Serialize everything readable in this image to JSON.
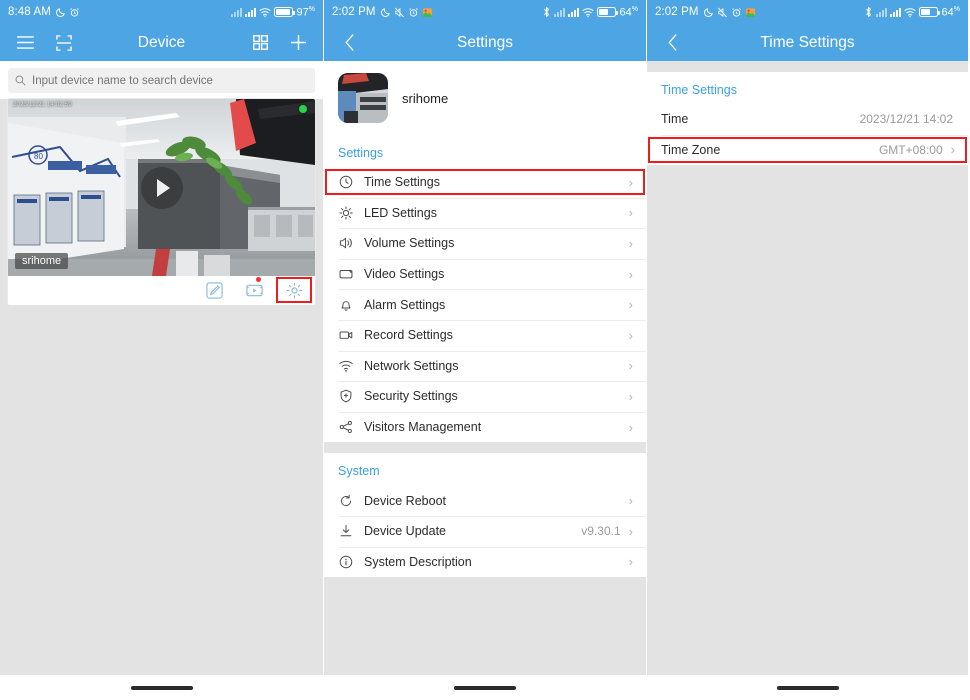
{
  "panel1": {
    "status": {
      "time": "8:48 AM",
      "battery": "97",
      "battery_pct_sym": "%",
      "icons": [
        "moon-icon",
        "alarm-icon",
        "signal-dim-icon",
        "signal-icon",
        "wifi-icon",
        "battery-icon"
      ]
    },
    "nav": {
      "title": "Device",
      "menu_icon": "hamburger-icon",
      "scan_icon": "scan-icon",
      "grid_icon": "grid-view-icon",
      "add_icon": "plus-icon"
    },
    "search": {
      "placeholder": "Input device name to search device",
      "value": "",
      "icon": "search-icon"
    },
    "device": {
      "name": "srihome",
      "timestamp_overlay": "2023/12/21 14:02:59",
      "online": true,
      "tools": [
        "edit-icon",
        "playback-icon",
        "settings-gear-icon"
      ],
      "highlight": "settings-gear-icon"
    }
  },
  "panel2": {
    "status": {
      "time": "2:02 PM",
      "battery": "64",
      "battery_pct_sym": "%",
      "icons": [
        "moon-icon",
        "mute-icon",
        "alarm-icon",
        "photo-icon",
        "bluetooth-icon",
        "signal-dim-icon",
        "signal-icon",
        "wifi-icon",
        "battery-icon"
      ]
    },
    "nav": {
      "title": "Settings",
      "back_icon": "chevron-left-icon"
    },
    "profile": {
      "name": "srihome",
      "avatar": "device-thumbnail"
    },
    "sections": [
      {
        "title": "Settings",
        "items": [
          {
            "label": "Time Settings",
            "icon": "clock-icon",
            "value": "",
            "highlighted": true
          },
          {
            "label": "LED Settings",
            "icon": "bulb-icon",
            "value": ""
          },
          {
            "label": "Volume Settings",
            "icon": "speaker-icon",
            "value": ""
          },
          {
            "label": "Video Settings",
            "icon": "monitor-icon",
            "value": ""
          },
          {
            "label": "Alarm Settings",
            "icon": "bell-icon",
            "value": ""
          },
          {
            "label": "Record Settings",
            "icon": "camcorder-icon",
            "value": ""
          },
          {
            "label": "Network Settings",
            "icon": "wifi-icon",
            "value": ""
          },
          {
            "label": "Security Settings",
            "icon": "shield-icon",
            "value": ""
          },
          {
            "label": "Visitors Management",
            "icon": "share-nodes-icon",
            "value": ""
          }
        ]
      },
      {
        "title": "System",
        "items": [
          {
            "label": "Device Reboot",
            "icon": "refresh-icon",
            "value": ""
          },
          {
            "label": "Device Update",
            "icon": "download-icon",
            "value": "v9.30.1"
          },
          {
            "label": "System Description",
            "icon": "info-icon",
            "value": ""
          }
        ]
      }
    ]
  },
  "panel3": {
    "status": {
      "time": "2:02 PM",
      "battery": "64",
      "battery_pct_sym": "%",
      "icons": [
        "moon-icon",
        "mute-icon",
        "alarm-icon",
        "photo-icon",
        "bluetooth-icon",
        "signal-dim-icon",
        "signal-icon",
        "wifi-icon",
        "battery-icon"
      ]
    },
    "nav": {
      "title": "Time Settings",
      "back_icon": "chevron-left-icon"
    },
    "section_title": "Time Settings",
    "items": [
      {
        "label": "Time",
        "value": "2023/12/21 14:02",
        "chevron": false,
        "highlighted": false
      },
      {
        "label": "Time Zone",
        "value": "GMT+08:00",
        "chevron": true,
        "highlighted": true
      }
    ]
  },
  "colors": {
    "header_blue": "#4ea5e4",
    "accent_blue": "#3ba0e3",
    "highlight_red": "#ee1c1c",
    "page_bg": "#e3e3e3",
    "online_green": "#27d34a",
    "badge_red": "#ff2d2d"
  }
}
